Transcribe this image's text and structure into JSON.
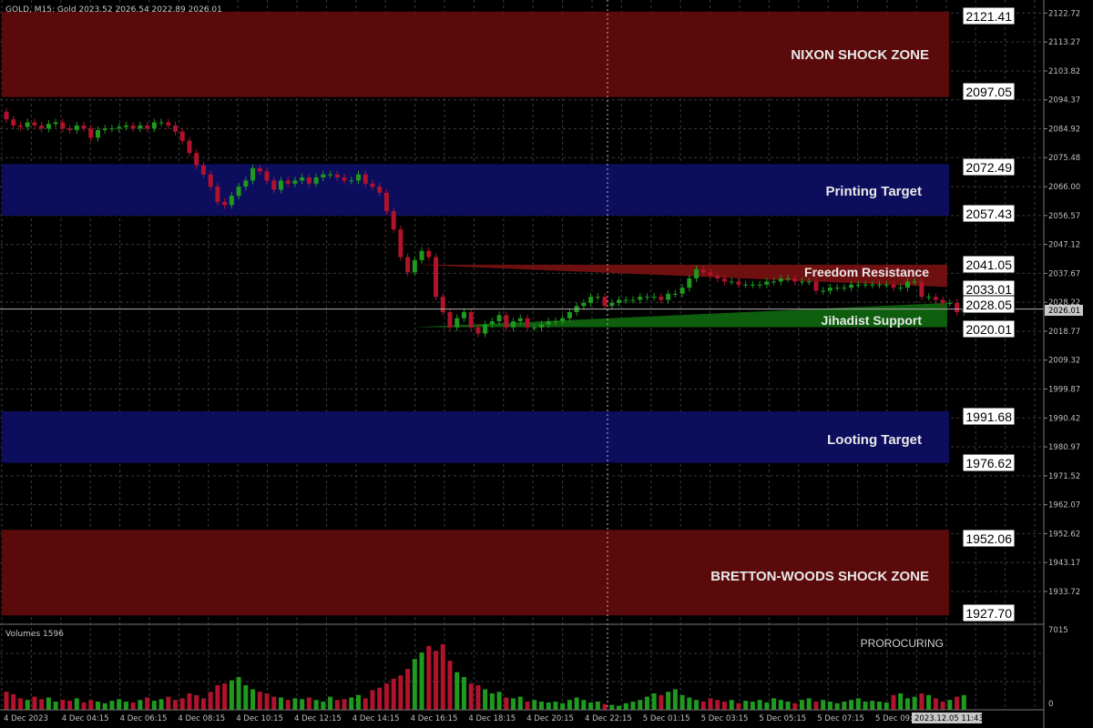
{
  "header": {
    "symbol_info": "GOLD, M15: Gold 2023.52 2026.54 2022.89 2026.01"
  },
  "colors": {
    "background": "#000000",
    "grid": "#3a3a3a",
    "bull": "#1f9a1f",
    "bear": "#b0132b",
    "shock_zone": "#5a0a0a",
    "target_zone": "#0d0d5e",
    "resistance_fill": "#6e1010",
    "support_fill": "#0e5e0e",
    "label_box_bg": "#ffffff",
    "current_line": "#b0b0b0"
  },
  "zones": [
    {
      "name": "NIXON SHOCK ZONE",
      "kind": "shock",
      "top": 2121.41,
      "bottom": 2097.05,
      "top_label": "2121.41",
      "bottom_label": "2097.05"
    },
    {
      "name": "Printing Target",
      "kind": "target",
      "top": 2072.49,
      "bottom": 2057.43,
      "top_label": "2072.49",
      "bottom_label": "2057.43"
    },
    {
      "name": "Looting Target",
      "kind": "target",
      "top": 1991.68,
      "bottom": 1976.62,
      "top_label": "1991.68",
      "bottom_label": "1976.62"
    },
    {
      "name": "BRETTON-WOODS SHOCK ZONE",
      "kind": "shock",
      "top": 1952.06,
      "bottom": 1927.7,
      "top_label": "1952.06",
      "bottom_label": "1927.70"
    }
  ],
  "wedge": {
    "resistance_label": "Freedom Resistance",
    "support_label": "Jihadist Support",
    "resistance_top_label": "2041.05",
    "resistance_bottom_label": "2033.01",
    "support_top_label": "2028.05",
    "support_bottom_label": "2020.01"
  },
  "price_axis": {
    "ticks": [
      "2122.72",
      "2113.27",
      "2103.82",
      "2094.37",
      "2084.92",
      "2075.48",
      "2066.00",
      "2056.57",
      "2047.12",
      "2037.67",
      "2028.22",
      "2018.77",
      "2009.32",
      "1999.87",
      "1990.42",
      "1980.97",
      "1971.52",
      "1962.07",
      "1952.62",
      "1943.17",
      "1933.72"
    ],
    "current_price": "2026.01"
  },
  "time_axis": {
    "ticks": [
      "4 Dec 2023",
      "4 Dec 04:15",
      "4 Dec 06:15",
      "4 Dec 08:15",
      "4 Dec 10:15",
      "4 Dec 12:15",
      "4 Dec 14:15",
      "4 Dec 16:15",
      "4 Dec 18:15",
      "4 Dec 20:15",
      "4 Dec 22:15",
      "5 Dec 01:15",
      "5 Dec 03:15",
      "5 Dec 05:15",
      "5 Dec 07:15",
      "5 Dec 09:15"
    ],
    "cursor_label": "2023.12.05 11:43"
  },
  "volume_panel": {
    "label": "Volumes 1596",
    "brand": "PROROCURING",
    "max_label": "7015",
    "zero_label": "0"
  },
  "chart_data": {
    "type": "candlestick",
    "symbol": "GOLD",
    "timeframe": "M15",
    "ylim": [
      1923,
      2127
    ],
    "open": [
      2090.5,
      2088,
      2086,
      2085.5,
      2087,
      2086,
      2085,
      2086.5,
      2087,
      2085,
      2084.5,
      2086,
      2085,
      2082,
      2084.5,
      2085,
      2085,
      2085.5,
      2086,
      2085,
      2086,
      2085,
      2087,
      2087,
      2086,
      2084,
      2081,
      2077,
      2073,
      2070,
      2066,
      2061,
      2060,
      2063,
      2066,
      2068,
      2072,
      2071,
      2068,
      2065,
      2068,
      2067,
      2068,
      2069,
      2067,
      2069,
      2070,
      2070,
      2069,
      2068,
      2068,
      2070,
      2067,
      2066,
      2064,
      2058,
      2052,
      2043,
      2038,
      2042,
      2045,
      2043,
      2030,
      2025,
      2020,
      2023,
      2025,
      2020,
      2018,
      2021,
      2022,
      2024,
      2020,
      2022,
      2023,
      2020,
      2020,
      2021,
      2022,
      2022,
      2023,
      2025,
      2027,
      2028,
      2030,
      2030,
      2027,
      2028,
      2029,
      2029,
      2029,
      2030,
      2030,
      2030,
      2029,
      2031,
      2031,
      2033,
      2036,
      2039,
      2038,
      2037,
      2036,
      2035,
      2035,
      2034,
      2034,
      2034,
      2034,
      2035,
      2035,
      2036,
      2036,
      2035,
      2035,
      2035,
      2032,
      2032,
      2033,
      2033,
      2033,
      2034,
      2034,
      2034,
      2034,
      2034,
      2034,
      2033,
      2033,
      2035,
      2035,
      2030,
      2030,
      2029,
      2028,
      2028,
      2025,
      2026
    ],
    "close": [
      2088,
      2086,
      2085.5,
      2087,
      2086,
      2085,
      2086.5,
      2087,
      2085,
      2084.5,
      2086,
      2085,
      2082,
      2084.5,
      2085,
      2085,
      2085.5,
      2086,
      2085,
      2086,
      2085,
      2087,
      2087,
      2086,
      2084,
      2081,
      2077,
      2073,
      2070,
      2066,
      2061,
      2060,
      2063,
      2066,
      2068,
      2072,
      2071,
      2068,
      2065,
      2068,
      2067,
      2068,
      2069,
      2067,
      2069,
      2070,
      2070,
      2069,
      2068,
      2068,
      2070,
      2067,
      2066,
      2064,
      2058,
      2052,
      2043,
      2038,
      2042,
      2045,
      2043,
      2030,
      2025,
      2020,
      2023,
      2025,
      2020,
      2018,
      2021,
      2022,
      2024,
      2020,
      2022,
      2023,
      2020,
      2020,
      2021,
      2022,
      2022,
      2023,
      2025,
      2027,
      2028,
      2030,
      2030,
      2027,
      2028,
      2029,
      2029,
      2029,
      2030,
      2030,
      2030,
      2029,
      2031,
      2031,
      2033,
      2036,
      2039,
      2038,
      2037,
      2036,
      2035,
      2035,
      2034,
      2034,
      2034,
      2034,
      2035,
      2035,
      2036,
      2036,
      2035,
      2035,
      2035,
      2032,
      2032,
      2033,
      2033,
      2033,
      2034,
      2034,
      2034,
      2034,
      2034,
      2034,
      2033,
      2033,
      2035,
      2035,
      2030,
      2030,
      2029,
      2028,
      2028,
      2025,
      2026,
      2026.01
    ],
    "volumes": [
      0.22,
      0.19,
      0.14,
      0.12,
      0.16,
      0.13,
      0.15,
      0.1,
      0.12,
      0.11,
      0.14,
      0.09,
      0.12,
      0.1,
      0.08,
      0.11,
      0.13,
      0.1,
      0.09,
      0.12,
      0.15,
      0.11,
      0.13,
      0.16,
      0.12,
      0.14,
      0.2,
      0.18,
      0.14,
      0.22,
      0.3,
      0.32,
      0.36,
      0.4,
      0.3,
      0.25,
      0.22,
      0.2,
      0.16,
      0.15,
      0.12,
      0.14,
      0.13,
      0.15,
      0.12,
      0.1,
      0.16,
      0.12,
      0.13,
      0.15,
      0.18,
      0.14,
      0.24,
      0.27,
      0.32,
      0.38,
      0.42,
      0.5,
      0.62,
      0.7,
      0.78,
      0.72,
      0.8,
      0.6,
      0.46,
      0.4,
      0.32,
      0.3,
      0.25,
      0.2,
      0.22,
      0.15,
      0.14,
      0.16,
      0.1,
      0.12,
      0.1,
      0.09,
      0.1,
      0.08,
      0.12,
      0.15,
      0.12,
      0.09,
      0.1,
      0.07,
      0.06,
      0.05,
      0.08,
      0.1,
      0.12,
      0.16,
      0.2,
      0.18,
      0.22,
      0.25,
      0.18,
      0.15,
      0.12,
      0.1,
      0.14,
      0.12,
      0.1,
      0.12,
      0.08,
      0.11,
      0.1,
      0.12,
      0.09,
      0.14,
      0.12,
      0.1,
      0.08,
      0.12,
      0.14,
      0.1,
      0.12,
      0.1,
      0.08,
      0.1,
      0.12,
      0.14,
      0.1,
      0.11,
      0.1,
      0.09,
      0.18,
      0.2,
      0.14,
      0.16,
      0.2,
      0.18,
      0.14,
      0.1,
      0.12,
      0.16,
      0.18
    ]
  }
}
